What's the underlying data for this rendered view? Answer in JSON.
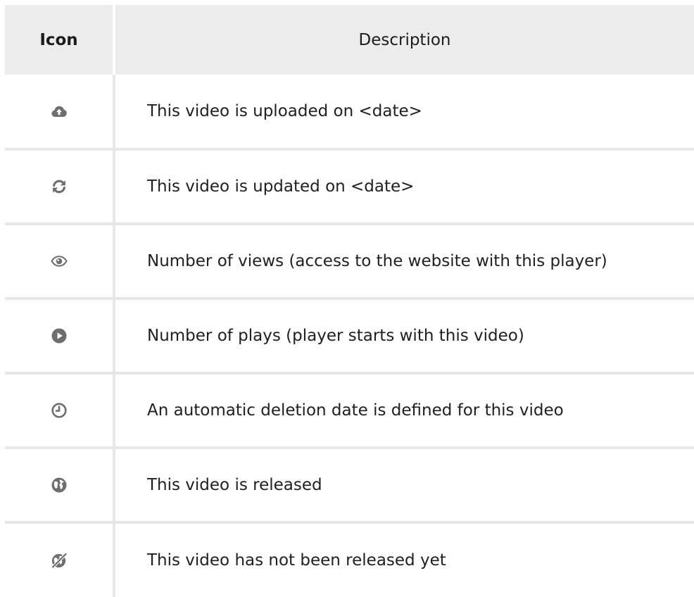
{
  "table": {
    "header": {
      "icon_label": "Icon",
      "description_label": "Description"
    },
    "rows": [
      {
        "icon": "cloud-upload-icon",
        "description": "This video is uploaded on <date>"
      },
      {
        "icon": "refresh-icon",
        "description": "This video is updated on <date>"
      },
      {
        "icon": "eye-icon",
        "description": "Number of views (access to the website with this player)"
      },
      {
        "icon": "play-circle-icon",
        "description": "Number of plays (player starts with this video)"
      },
      {
        "icon": "clock-icon",
        "description": "An automatic deletion date is defined for this video"
      },
      {
        "icon": "globe-icon",
        "description": "This video is released"
      },
      {
        "icon": "globe-slash-icon",
        "description": "This video has not been released yet"
      }
    ]
  },
  "colors": {
    "icon": "#6e6e6e",
    "header_background": "#ececec",
    "grid_lines": "#e6e6e6"
  }
}
